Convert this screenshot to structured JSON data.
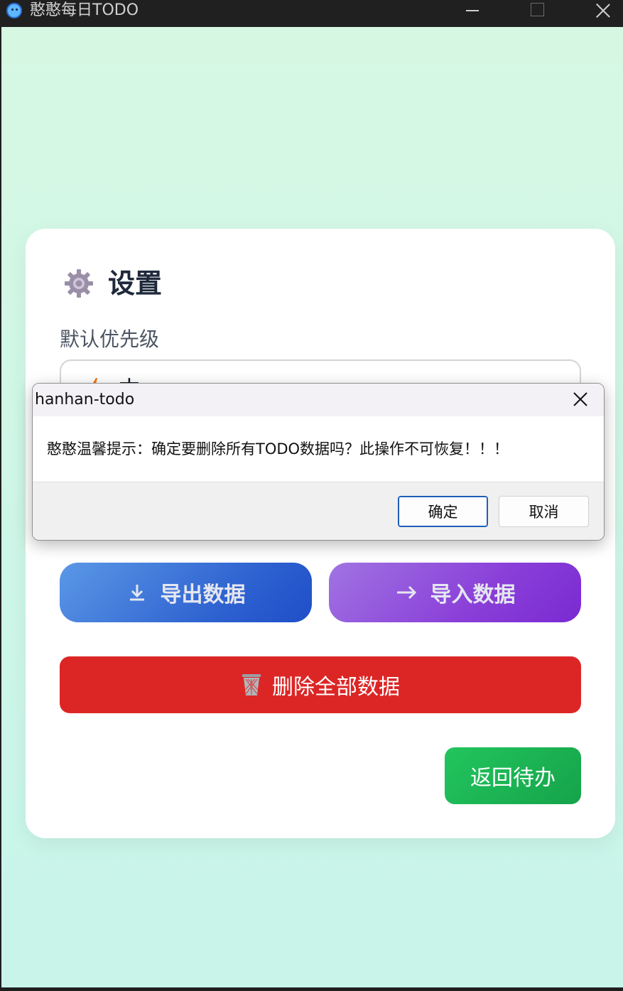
{
  "window": {
    "title": "憨憨每日TODO",
    "icon": "smiley-app-icon"
  },
  "settings": {
    "title": "设置",
    "title_icon": "gear-icon",
    "priority_label": "默认优先级",
    "priority_value": "中",
    "priority_icon": "lightning-bolt-icon",
    "export_label": "导出数据",
    "import_label": "导入数据",
    "delete_label": "删除全部数据",
    "back_label": "返回待办",
    "colors": {
      "delete": "#dc2626",
      "back": "#22c55e",
      "export": "#2c5fcf",
      "import": "#8a3fd8",
      "bolt": "#f97316"
    }
  },
  "dialog": {
    "title": "hanhan-todo",
    "message": "憨憨温馨提示：确定要删除所有TODO数据吗？此操作不可恢复！！！",
    "ok_label": "确定",
    "cancel_label": "取消"
  }
}
